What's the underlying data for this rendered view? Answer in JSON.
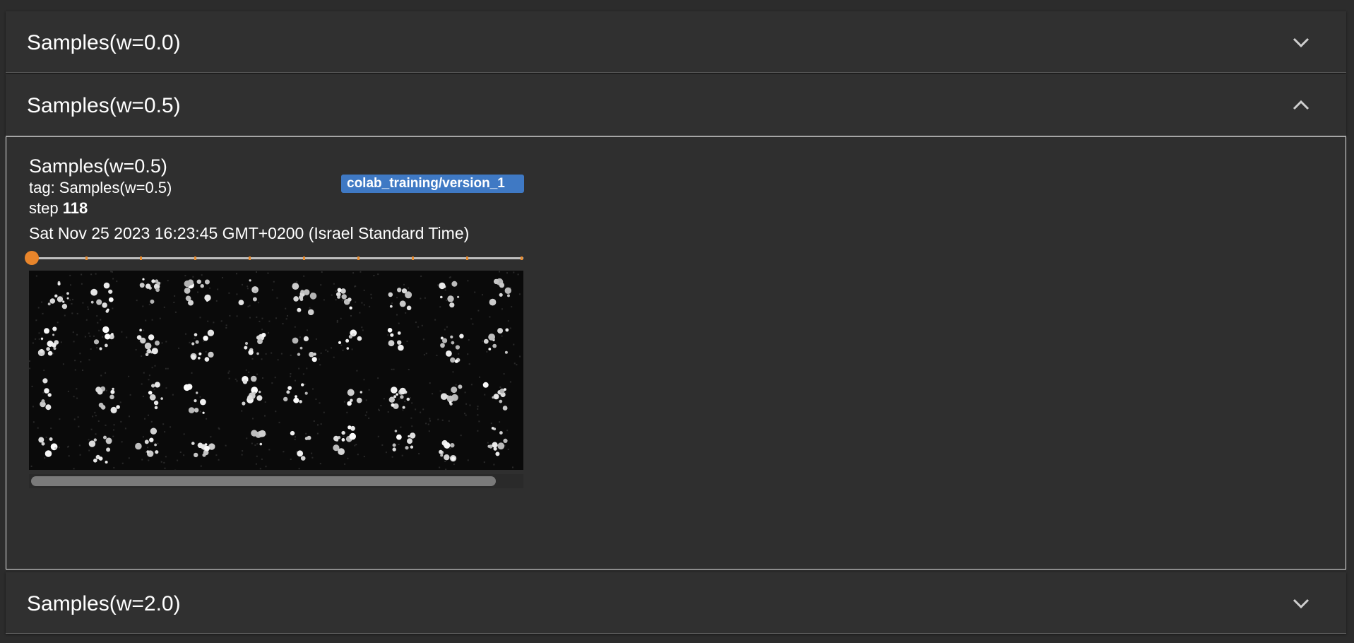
{
  "panes": [
    {
      "title": "Samples(w=0.0)",
      "state": "collapsed",
      "toggle_icon": "chevron-down-icon"
    },
    {
      "title": "Samples(w=0.5)",
      "state": "expanded",
      "toggle_icon": "chevron-up-icon"
    },
    {
      "title": "Samples(w=2.0)",
      "state": "collapsed",
      "toggle_icon": "chevron-down-icon"
    }
  ],
  "card": {
    "title": "Samples(w=0.5)",
    "run": "colab_training/version_1",
    "tag_text": "tag: Samples(w=0.5)",
    "step_label": "step",
    "step_value": "118",
    "timestamp": "Sat Nov 25 2023 16:23:45 GMT+0200 (Israel Standard Time)",
    "step_slider_position": 0,
    "image_grid": {
      "rows": 4,
      "cols": 10,
      "description_icon": "generated-samples-image"
    }
  },
  "colors": {
    "background": "#2c2c2c",
    "header": "#303030",
    "badge": "#3f79c4",
    "slider_accent": "#e8852b"
  }
}
